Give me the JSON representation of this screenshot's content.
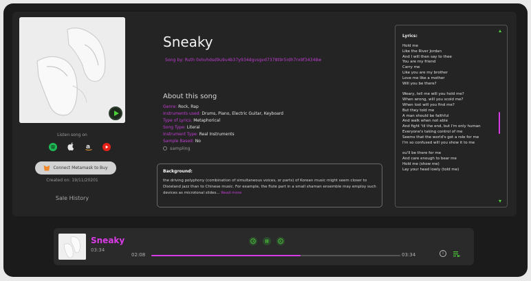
{
  "song": {
    "title": "Sneaky",
    "song_by": "Song by: Ruth 0xhvhdsd9u9u4b37y934dgvsgvd7378t9r5rdh7rx9f34348w",
    "about_title": "About this song",
    "meta": [
      {
        "k": "Genre:",
        "v": " Rock, Rap"
      },
      {
        "k": "Instruments used:",
        "v": " Drums, Piano, Electric Guitar, Keyboard"
      },
      {
        "k": "Type of Lyrics:",
        "v": "  Metaphorical"
      },
      {
        "k": "Song Type:",
        "v": " Literal"
      },
      {
        "k": "Instrument Type:",
        "v": " Real Instruments"
      },
      {
        "k": "Sample Based:",
        "v": " No"
      }
    ],
    "sampling": "sampling",
    "background_title": "Background:",
    "background_text": "the driving polyphony (combination of simultaneous voices, or parts) of Korean music might seem closer to Dixieland jazz than to Chinese music. For example, the flute part in a small shaman ensemble may employ such devices as microtonal slides...",
    "read_more": "Read more"
  },
  "left": {
    "listen_label": "Listen song on",
    "stores": [
      {
        "icon": "spotify-icon",
        "color": "#1db954"
      },
      {
        "icon": "apple-icon",
        "color": "#e6e6e6"
      },
      {
        "icon": "amazon-icon",
        "color": "#e6e6e6"
      },
      {
        "icon": "youtube-icon",
        "color": "#e62117"
      }
    ],
    "connect_label": "Connect Metamask to Buy",
    "created": "Created on: 19/11/20201",
    "sale_history": "Sale History"
  },
  "lyrics": {
    "title": "Lyrics:",
    "lines": [
      "Hold me",
      "Like the River Jordan",
      "And I will then say to thee",
      "You are my friend",
      "Carry me",
      "Like you are my brother",
      "Love me like a mother",
      "Will you be there?",
      "",
      "Weary, tell me will you hold me?",
      "When wrong, will you scold me?",
      "When lost will you find me?",
      "But they told me",
      "A man should be faithful",
      "And walk when not able",
      "And fight 'til the end, but I'm only human",
      "Everyone's taking control of me",
      "Seems that the world's got a role for me",
      "I'm so confused will you show it to me",
      "",
      "ou'll be there for me",
      "And care enough to bear me",
      "Hold me (show me)",
      "Lay your head lowly (told me)"
    ]
  },
  "player": {
    "title": "Sneaky",
    "duration": "03:34",
    "elapsed": "02:08",
    "total": "03:34",
    "progress": 0.6
  },
  "colors": {
    "accent": "#d93be6",
    "green": "#4cd137"
  }
}
